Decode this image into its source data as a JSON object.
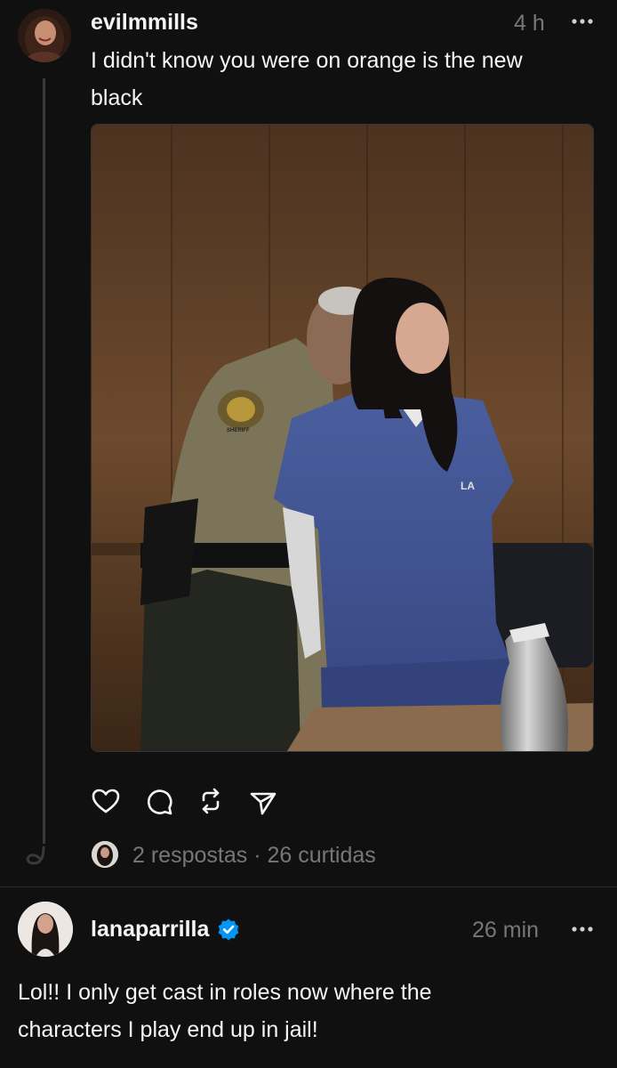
{
  "post": {
    "username": "evilmmills",
    "time": "4 h",
    "text": "I didn't know you were on orange is the new black",
    "photo_badge_text": "LA",
    "photo_patch_text": "SHERIFF",
    "stats": {
      "replies": "2 respostas",
      "separator": "·",
      "likes": "26 curtidas"
    }
  },
  "reply": {
    "username": "lanaparrilla",
    "verified": true,
    "time": "26 min",
    "text": "Lol!! I only get cast in roles now where the characters I play end up in jail!"
  },
  "icons": {
    "like": "heart-icon",
    "comment": "comment-icon",
    "repost": "repost-icon",
    "share": "send-icon",
    "more": "more-icon",
    "verified": "verified-badge-icon"
  },
  "colors": {
    "background": "#101010",
    "text": "#f3f5f7",
    "secondary": "#777777",
    "verified": "#0095f6"
  }
}
